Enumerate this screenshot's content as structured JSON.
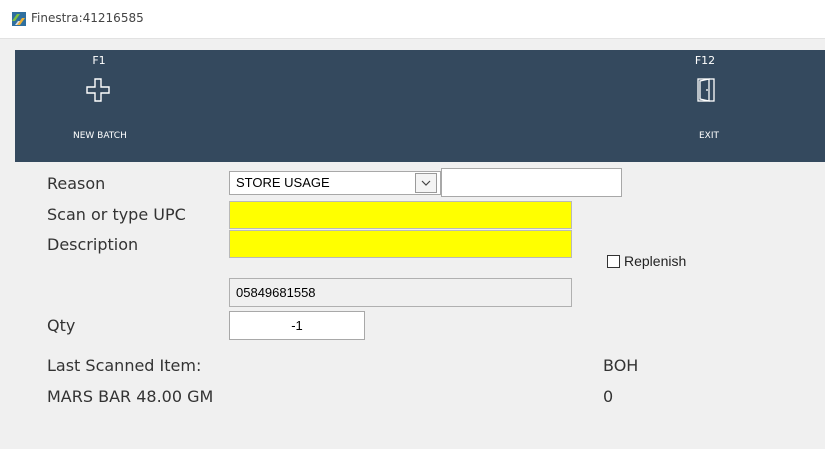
{
  "window": {
    "title": "Finestra:41216585",
    "icon": "finestra-app-icon"
  },
  "colors": {
    "toolbar_bg": "#34495e",
    "highlight_field": "#ffff00",
    "window_bg": "#f0f0f0"
  },
  "toolbar": {
    "new_batch": {
      "key": "F1",
      "label": "NEW BATCH",
      "icon": "plus-outline-icon"
    },
    "exit": {
      "key": "F12",
      "label": "EXIT",
      "icon": "door-exit-icon"
    }
  },
  "form": {
    "reason": {
      "label": "Reason",
      "selected": "STORE USAGE",
      "extra_value": ""
    },
    "upc": {
      "label": "Scan or type UPC",
      "value": ""
    },
    "description": {
      "label": "Description",
      "value": ""
    },
    "replenish": {
      "label": "Replenish",
      "checked": false
    },
    "upc_display": "05849681558",
    "qty": {
      "label": "Qty",
      "value": "-1"
    }
  },
  "last_scanned": {
    "label": "Last Scanned Item:",
    "item": "MARS BAR 48.00 GM",
    "boh_label": "BOH",
    "boh_value": "0"
  }
}
